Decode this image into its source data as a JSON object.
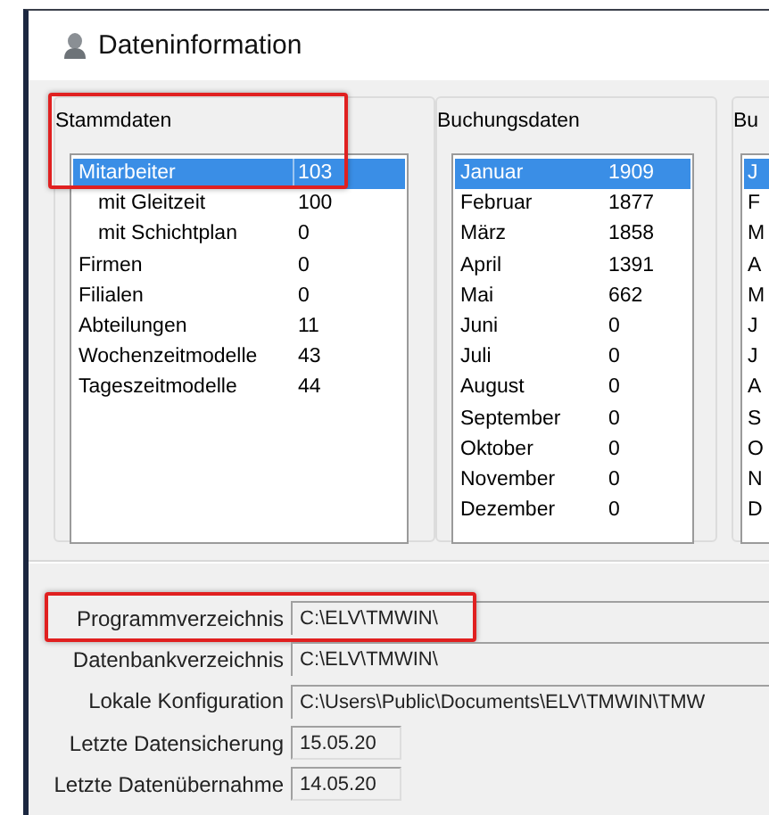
{
  "window": {
    "title": "Dateninformation"
  },
  "groups": [
    {
      "title": "Stammdaten",
      "highlighted": true,
      "rows": [
        {
          "label": "Mitarbeiter",
          "value": "103",
          "selected": true,
          "children": [
            {
              "label": "mit Gleitzeit",
              "value": "100",
              "selected": false
            },
            {
              "label": "mit Schichtplan",
              "value": "0",
              "selected": false
            }
          ]
        },
        {
          "label": "Firmen",
          "value": "0",
          "selected": false
        },
        {
          "label": "Filialen",
          "value": "0",
          "selected": false
        },
        {
          "label": "Abteilungen",
          "value": "11",
          "selected": false
        },
        {
          "label": "Wochenzeitmodelle",
          "value": "43",
          "selected": false
        },
        {
          "label": "Tageszeitmodelle",
          "value": "44",
          "selected": false
        }
      ]
    },
    {
      "title": "Buchungsdaten",
      "highlighted": false,
      "rows": [
        {
          "label": "Januar",
          "value": "1909",
          "selected": true
        },
        {
          "label": "Februar",
          "value": "1877",
          "selected": false
        },
        {
          "label": "März",
          "value": "1858",
          "selected": false
        },
        {
          "label": "April",
          "value": "1391",
          "selected": false
        },
        {
          "label": "Mai",
          "value": "662",
          "selected": false
        },
        {
          "label": "Juni",
          "value": "0",
          "selected": false
        },
        {
          "label": "Juli",
          "value": "0",
          "selected": false
        },
        {
          "label": "August",
          "value": "0",
          "selected": false
        },
        {
          "label": "September",
          "value": "0",
          "selected": false
        },
        {
          "label": "Oktober",
          "value": "0",
          "selected": false
        },
        {
          "label": "November",
          "value": "0",
          "selected": false
        },
        {
          "label": "Dezember",
          "value": "0",
          "selected": false
        }
      ]
    },
    {
      "title": "Bu",
      "highlighted": false,
      "rows": [
        {
          "label": "J",
          "selected": true
        },
        {
          "label": "F",
          "selected": false
        },
        {
          "label": "M",
          "selected": false
        },
        {
          "label": "A",
          "selected": false
        },
        {
          "label": "M",
          "selected": false
        },
        {
          "label": "J",
          "selected": false
        },
        {
          "label": "J",
          "selected": false
        },
        {
          "label": "A",
          "selected": false
        },
        {
          "label": "S",
          "selected": false
        },
        {
          "label": "O",
          "selected": false
        },
        {
          "label": "N",
          "selected": false
        },
        {
          "label": "D",
          "selected": false
        }
      ]
    }
  ],
  "paths": [
    {
      "label": "Programmverzeichnis",
      "value": "C:\\ELV\\TMWIN\\",
      "highlighted": true,
      "kind": "wide"
    },
    {
      "label": "Datenbankverzeichnis",
      "value": "C:\\ELV\\TMWIN\\",
      "highlighted": false,
      "kind": "wide"
    },
    {
      "label": "Lokale Konfiguration",
      "value": "C:\\Users\\Public\\Documents\\ELV\\TMWIN\\TMW",
      "highlighted": false,
      "kind": "wide"
    },
    {
      "label": "Letzte Datensicherung",
      "value": "15.05.20",
      "highlighted": false,
      "kind": "short"
    },
    {
      "label": "Letzte Datenübernahme",
      "value": "14.05.20",
      "highlighted": false,
      "kind": "short"
    }
  ]
}
